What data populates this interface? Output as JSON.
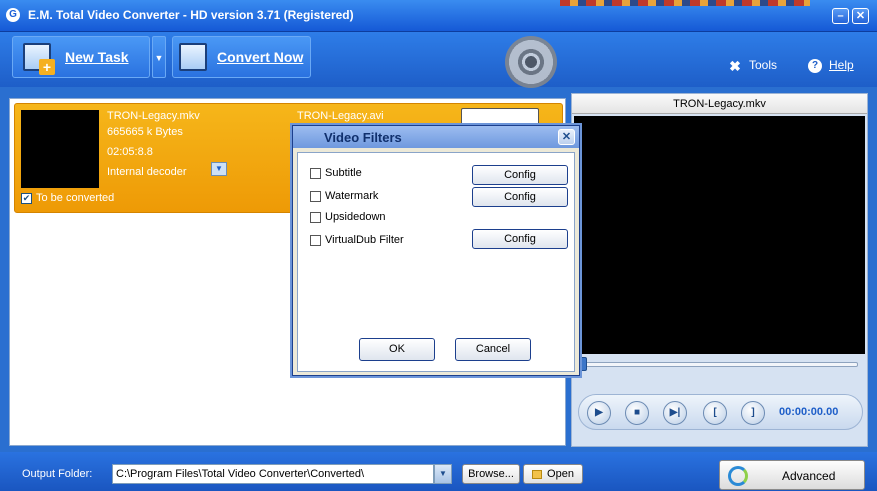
{
  "window": {
    "title": "E.M. Total Video Converter -  HD version 3.71 (Registered)",
    "minimize_glyph": "–",
    "close_glyph": "✕"
  },
  "toolbar": {
    "new_task_label": "New Task",
    "convert_now_label": "Convert Now",
    "tools_label": "Tools",
    "help_label": "Help"
  },
  "task": {
    "source_name": "TRON-Legacy.mkv",
    "size": "665665 k Bytes",
    "duration": "02:05:8.8",
    "decoder": "Internal decoder",
    "target_name": "TRON-Legacy.avi",
    "to_be_converted_label": "To be converted",
    "to_be_converted_checked": true
  },
  "preview": {
    "title": "TRON-Legacy.mkv",
    "position": 0,
    "time": "00:00:00.00"
  },
  "bottom": {
    "output_folder_label": "Output Folder:",
    "output_folder_value": "C:\\Program Files\\Total Video Converter\\Converted\\",
    "browse_label": "Browse...",
    "open_label": "Open",
    "advanced_label": "Advanced"
  },
  "dialog": {
    "title": "Video Filters",
    "close_glyph": "✕",
    "filters": [
      {
        "label": "Subtitle",
        "checked": false,
        "has_config": true
      },
      {
        "label": "Watermark",
        "checked": false,
        "has_config": true
      },
      {
        "label": "Upsidedown",
        "checked": false,
        "has_config": false
      },
      {
        "label": "VirtualDub Filter",
        "checked": false,
        "has_config": true
      }
    ],
    "config_label": "Config",
    "ok_label": "OK",
    "cancel_label": "Cancel"
  },
  "colors": {
    "accent_blue": "#1e5ec8",
    "task_orange": "#f2a70e",
    "dialog_bg": "#ece9d8"
  }
}
